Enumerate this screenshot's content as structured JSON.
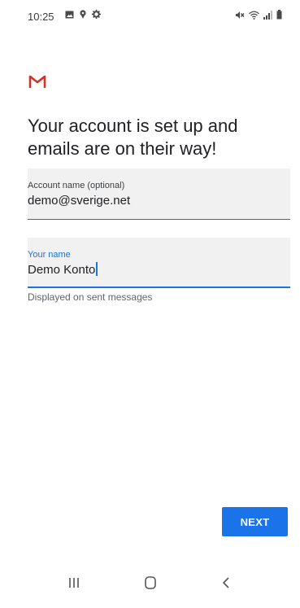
{
  "status_bar": {
    "time": "10:25",
    "left_icons": [
      "gallery-icon",
      "location-icon",
      "settings-icon"
    ],
    "right_icons": [
      "mute-icon",
      "wifi-icon",
      "signal-icon",
      "battery-icon"
    ]
  },
  "app": {
    "logo": "gmail-logo",
    "brand_color": "#d93025"
  },
  "headline": "Your account is set up and emails are on their way!",
  "account_field": {
    "label": "Account name (optional)",
    "value": "demo@sverige.net"
  },
  "name_field": {
    "label": "Your name",
    "value": "Demo Konto",
    "focused": true,
    "accent_color": "#1a73e8"
  },
  "helper_text": "Displayed on sent messages",
  "next_button": {
    "label": "NEXT",
    "color": "#1a73e8"
  },
  "nav_bar": {
    "icons": [
      "recents-icon",
      "home-icon",
      "back-icon"
    ]
  }
}
